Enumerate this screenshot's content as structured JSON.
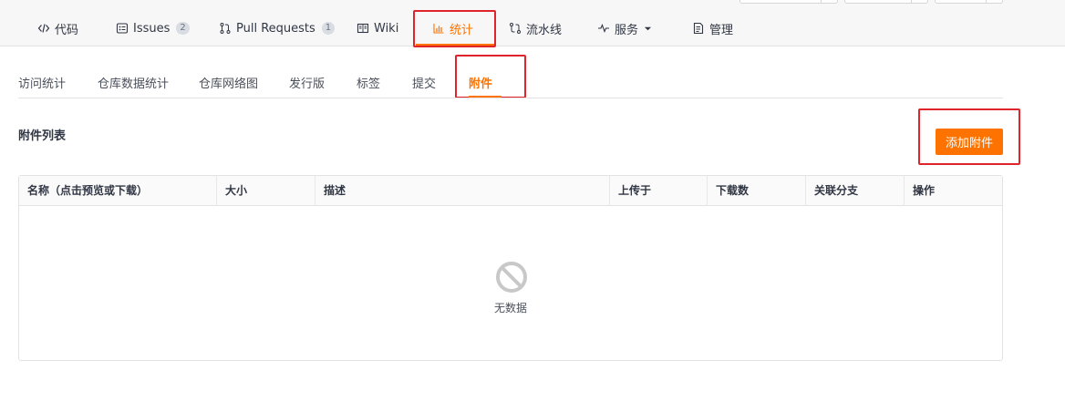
{
  "nav": {
    "items": [
      {
        "label": "代码",
        "icon": "code-icon"
      },
      {
        "label": "Issues",
        "badge": "2",
        "icon": "issues-icon"
      },
      {
        "label": "Pull Requests",
        "badge": "1",
        "icon": "pull-request-icon"
      },
      {
        "label": "Wiki",
        "icon": "book-icon"
      },
      {
        "label": "统计",
        "icon": "bar-chart-icon",
        "active": true
      },
      {
        "label": "流水线",
        "icon": "pipeline-icon"
      },
      {
        "label": "服务",
        "icon": "pulse-icon",
        "dropdown": true
      },
      {
        "label": "管理",
        "icon": "document-icon"
      }
    ]
  },
  "subtabs": [
    "访问统计",
    "仓库数据统计",
    "仓库网络图",
    "发行版",
    "标签",
    "提交",
    "附件"
  ],
  "active_subtab": "附件",
  "section": {
    "title": "附件列表",
    "add_button": "添加附件"
  },
  "table": {
    "columns": [
      "名称（点击预览或下载）",
      "大小",
      "描述",
      "上传于",
      "下载数",
      "关联分支",
      "操作"
    ],
    "empty_text": "无数据"
  },
  "colors": {
    "accent": "#fe7300",
    "highlight": "#e0242b",
    "text": "#303643"
  }
}
